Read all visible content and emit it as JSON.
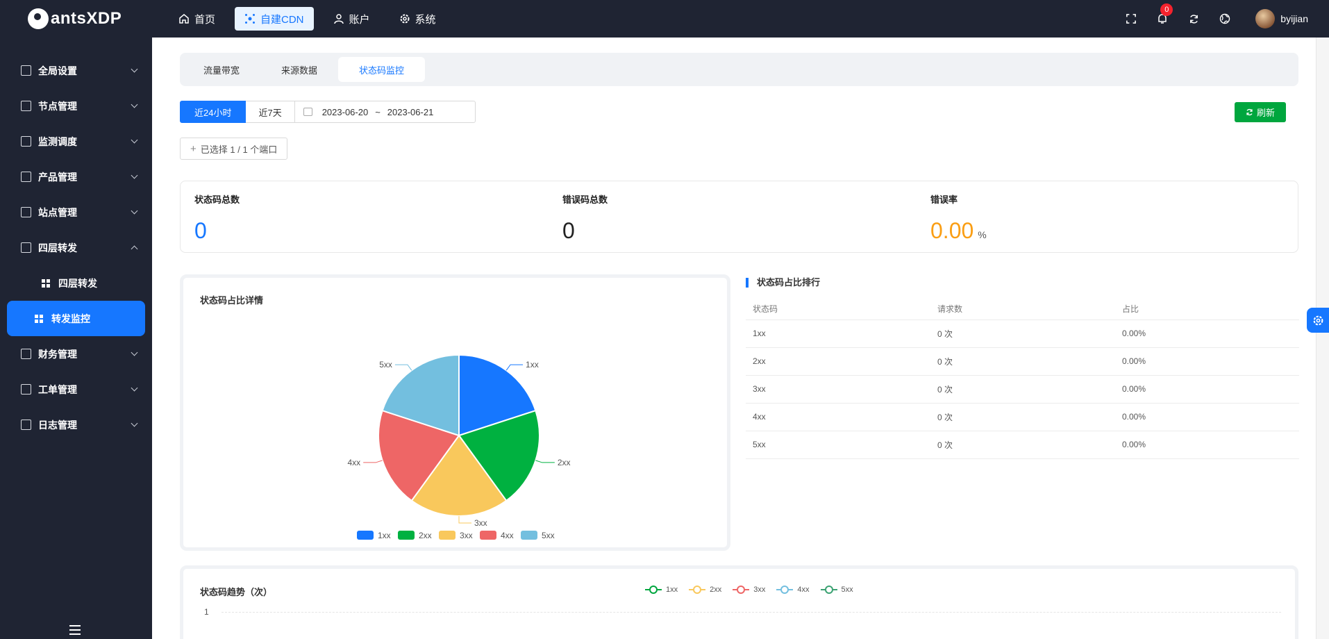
{
  "brand": {
    "name": "antsXDP"
  },
  "topnav": [
    {
      "label": "首页",
      "icon": "home-icon",
      "active": false
    },
    {
      "label": "自建CDN",
      "icon": "network-icon",
      "active": true
    },
    {
      "label": "账户",
      "icon": "user-icon",
      "active": false
    },
    {
      "label": "系统",
      "icon": "gear-icon",
      "active": false
    }
  ],
  "header": {
    "notification_count": "0",
    "username": "byijian"
  },
  "sidebar": {
    "items": [
      {
        "label": "全局设置"
      },
      {
        "label": "节点管理"
      },
      {
        "label": "监测调度"
      },
      {
        "label": "产品管理"
      },
      {
        "label": "站点管理"
      },
      {
        "label": "四层转发"
      },
      {
        "label": "财务管理"
      },
      {
        "label": "工单管理"
      },
      {
        "label": "日志管理"
      }
    ],
    "sub": [
      {
        "label": "四层转发",
        "active": false
      },
      {
        "label": "转发监控",
        "active": true
      }
    ]
  },
  "tabs": [
    {
      "label": "流量带宽"
    },
    {
      "label": "来源数据"
    },
    {
      "label": "状态码监控"
    }
  ],
  "filters": {
    "last24h": "近24小时",
    "last7d": "近7天",
    "date_from": "2023-06-20",
    "date_sep": "~",
    "date_to": "2023-06-21",
    "refresh": "刷新",
    "port_selector": "已选择 1 / 1 个端口"
  },
  "stats": {
    "total_label": "状态码总数",
    "total_value": "0",
    "error_label": "错误码总数",
    "error_value": "0",
    "rate_label": "错误率",
    "rate_value": "0.00",
    "rate_unit": "%"
  },
  "colors": {
    "1xx": "#1677ff",
    "2xx": "#00b140",
    "3xx": "#f9c85c",
    "4xx": "#ee6666",
    "5xx": "#73bfdf",
    "accent": "#1677ff",
    "warning": "#fa9e14",
    "refresh": "#00a63e"
  },
  "pie": {
    "title": "状态码占比详情",
    "legend": [
      "1xx",
      "2xx",
      "3xx",
      "4xx",
      "5xx"
    ]
  },
  "chart_data": [
    {
      "type": "pie",
      "title": "状态码占比详情",
      "categories": [
        "1xx",
        "2xx",
        "3xx",
        "4xx",
        "5xx"
      ],
      "values": [
        1,
        1,
        1,
        1,
        1
      ],
      "legend": "bottom"
    },
    {
      "type": "line",
      "title": "状态码趋势（次）",
      "series": [
        {
          "name": "1xx",
          "values": []
        },
        {
          "name": "2xx",
          "values": []
        },
        {
          "name": "3xx",
          "values": []
        },
        {
          "name": "4xx",
          "values": []
        },
        {
          "name": "5xx",
          "values": []
        }
      ],
      "y_ticks": [
        "1"
      ],
      "legend": "top"
    }
  ],
  "rank": {
    "title": "状态码占比排行",
    "columns": [
      "状态码",
      "请求数",
      "占比"
    ],
    "rows": [
      [
        "1xx",
        "0 次",
        "0.00%"
      ],
      [
        "2xx",
        "0 次",
        "0.00%"
      ],
      [
        "3xx",
        "0 次",
        "0.00%"
      ],
      [
        "4xx",
        "0 次",
        "0.00%"
      ],
      [
        "5xx",
        "0 次",
        "0.00%"
      ]
    ]
  },
  "trend": {
    "title": "状态码趋势（次）",
    "legend": [
      {
        "name": "1xx",
        "color": "#00a63e"
      },
      {
        "name": "2xx",
        "color": "#f9c85c"
      },
      {
        "name": "3xx",
        "color": "#ee6666"
      },
      {
        "name": "4xx",
        "color": "#73bfdf"
      },
      {
        "name": "5xx",
        "color": "#3ba272"
      }
    ],
    "ytick": "1"
  }
}
